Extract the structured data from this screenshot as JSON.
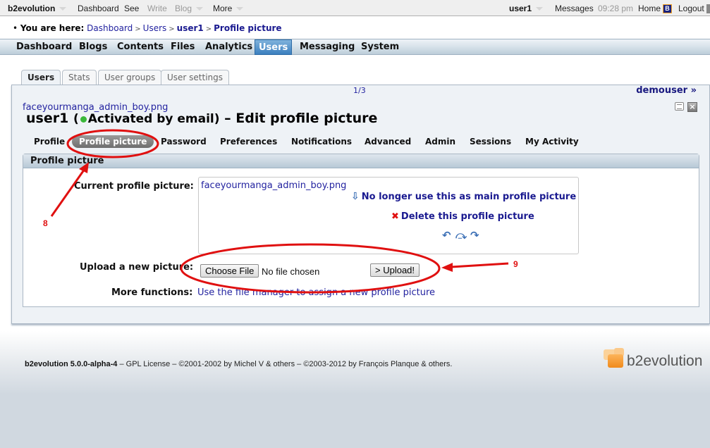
{
  "topbar": {
    "brand": "b2evolution",
    "menu": [
      "Dashboard",
      "See",
      "Write",
      "Blog",
      "More"
    ],
    "user": "user1",
    "messages": "Messages",
    "time": "09:28 pm",
    "home": "Home",
    "logout": "Logout"
  },
  "breadcrumb": {
    "label": "You are here:",
    "items": [
      "Dashboard",
      "Users",
      "user1",
      "Profile picture"
    ]
  },
  "mainnav": {
    "items": [
      "Dashboard",
      "Blogs",
      "Contents",
      "Files",
      "Analytics",
      "Users",
      "Messaging",
      "System"
    ],
    "active": "Users"
  },
  "subtabs": {
    "items": [
      "Users",
      "Stats",
      "User groups",
      "User settings"
    ],
    "active": "Users"
  },
  "panel": {
    "counter": "1/3",
    "next_user": "demouser »",
    "avatar_file": "faceyourmanga_admin_boy.png",
    "title_user": "user1",
    "title_status": "Activated by email",
    "title_rest": "– Edit profile picture",
    "user_tabs": [
      "Profile",
      "Profile picture",
      "Password",
      "Preferences",
      "Notifications",
      "Advanced",
      "Admin",
      "Sessions",
      "My Activity"
    ],
    "active_user_tab": "Profile picture"
  },
  "form": {
    "legend": "Profile picture",
    "current_label": "Current profile picture:",
    "current_file": "faceyourmanga_admin_boy.png",
    "action_unset": "No longer use this as main profile picture",
    "action_delete": "Delete this profile picture",
    "upload_label": "Upload a new picture:",
    "choose_file": "Choose File",
    "no_file": "No file chosen",
    "upload_button": "> Upload!",
    "more_label": "More functions:",
    "more_link": "Use the file manager to assign a new profile picture"
  },
  "annotations": {
    "n8": "8",
    "n9": "9",
    "color": "#e01010"
  },
  "footer": {
    "version": "b2evolution 5.0.0-alpha-4",
    "text": " – GPL License – ©2001-2002 by Michel V & others – ©2003-2012 by François Planque & others.",
    "logo_text": "b2evolution"
  }
}
